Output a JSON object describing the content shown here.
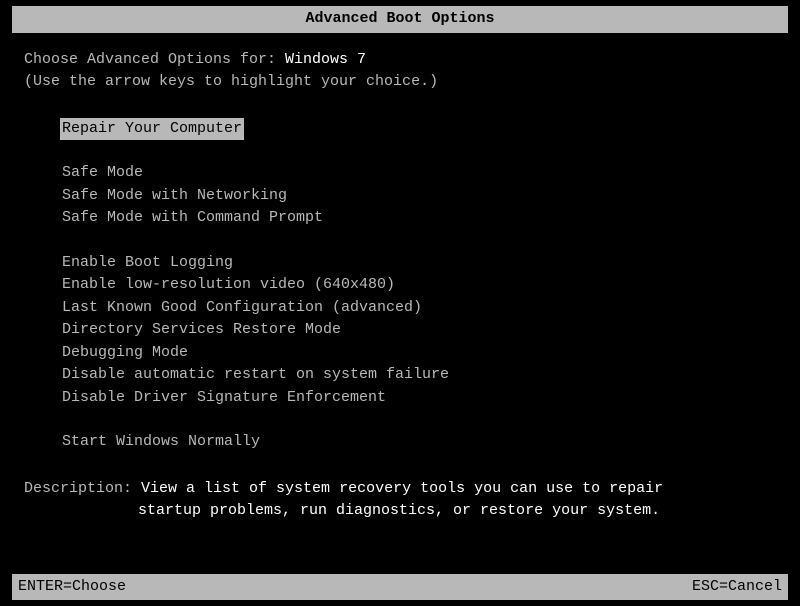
{
  "title": "Advanced Boot Options",
  "prompt_prefix": "Choose Advanced Options for: ",
  "os": "Windows 7",
  "hint": "(Use the arrow keys to highlight your choice.)",
  "menu": {
    "selected_index": 0,
    "items": [
      "Repair Your Computer",
      "Safe Mode",
      "Safe Mode with Networking",
      "Safe Mode with Command Prompt",
      "Enable Boot Logging",
      "Enable low-resolution video (640x480)",
      "Last Known Good Configuration (advanced)",
      "Directory Services Restore Mode",
      "Debugging Mode",
      "Disable automatic restart on system failure",
      "Disable Driver Signature Enforcement",
      "Start Windows Normally"
    ]
  },
  "description_label": "Description: ",
  "description_line1": "View a list of system recovery tools you can use to repair",
  "description_line2": "startup problems, run diagnostics, or restore your system.",
  "footer": {
    "enter": "ENTER=Choose",
    "esc": "ESC=Cancel"
  }
}
